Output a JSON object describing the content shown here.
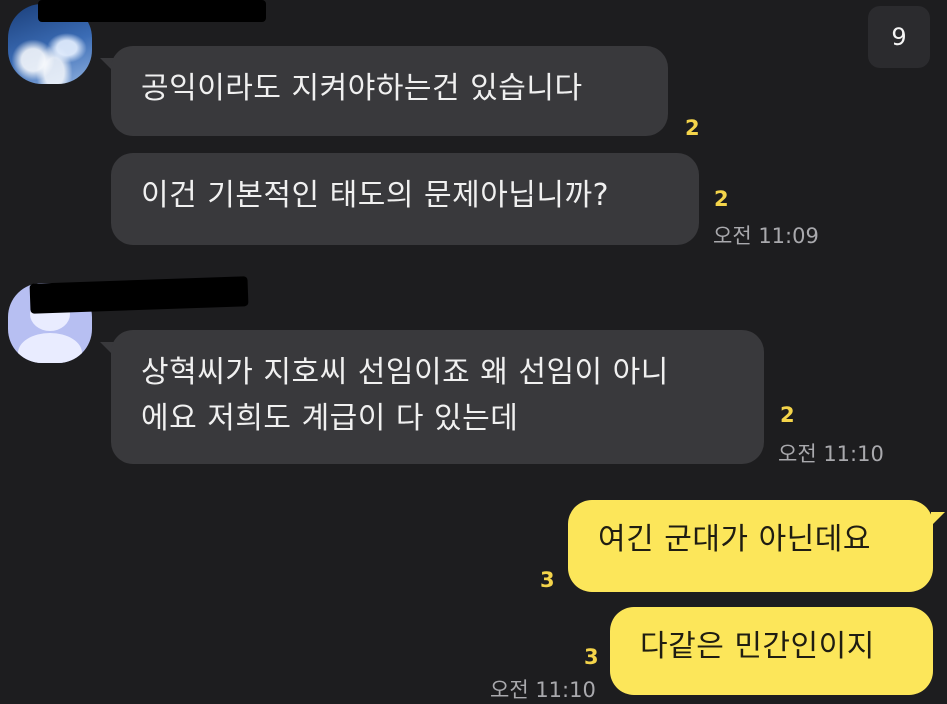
{
  "badge": {
    "count": "9"
  },
  "messages": [
    {
      "text": "공익이라도 지켜야하는건 있습니다",
      "unread": "2"
    },
    {
      "text": "이건 기본적인 태도의 문제아닙니까?",
      "unread": "2",
      "time": "오전 11:09"
    },
    {
      "line1": "상혁씨가 지호씨 선임이죠 왜 선임이 아니",
      "line2": "에요 저희도 계급이 다 있는데",
      "unread": "2",
      "time": "오전 11:10"
    },
    {
      "text": "여긴 군대가 아닌데요",
      "unread": "3"
    },
    {
      "text": "다같은 민간인이지",
      "unread": "3",
      "time": "오전 11:10"
    }
  ],
  "colors": {
    "background": "#1d1d1f",
    "incoming": "#39393c",
    "outgoing": "#fce65a",
    "unread": "#f4d44a"
  }
}
